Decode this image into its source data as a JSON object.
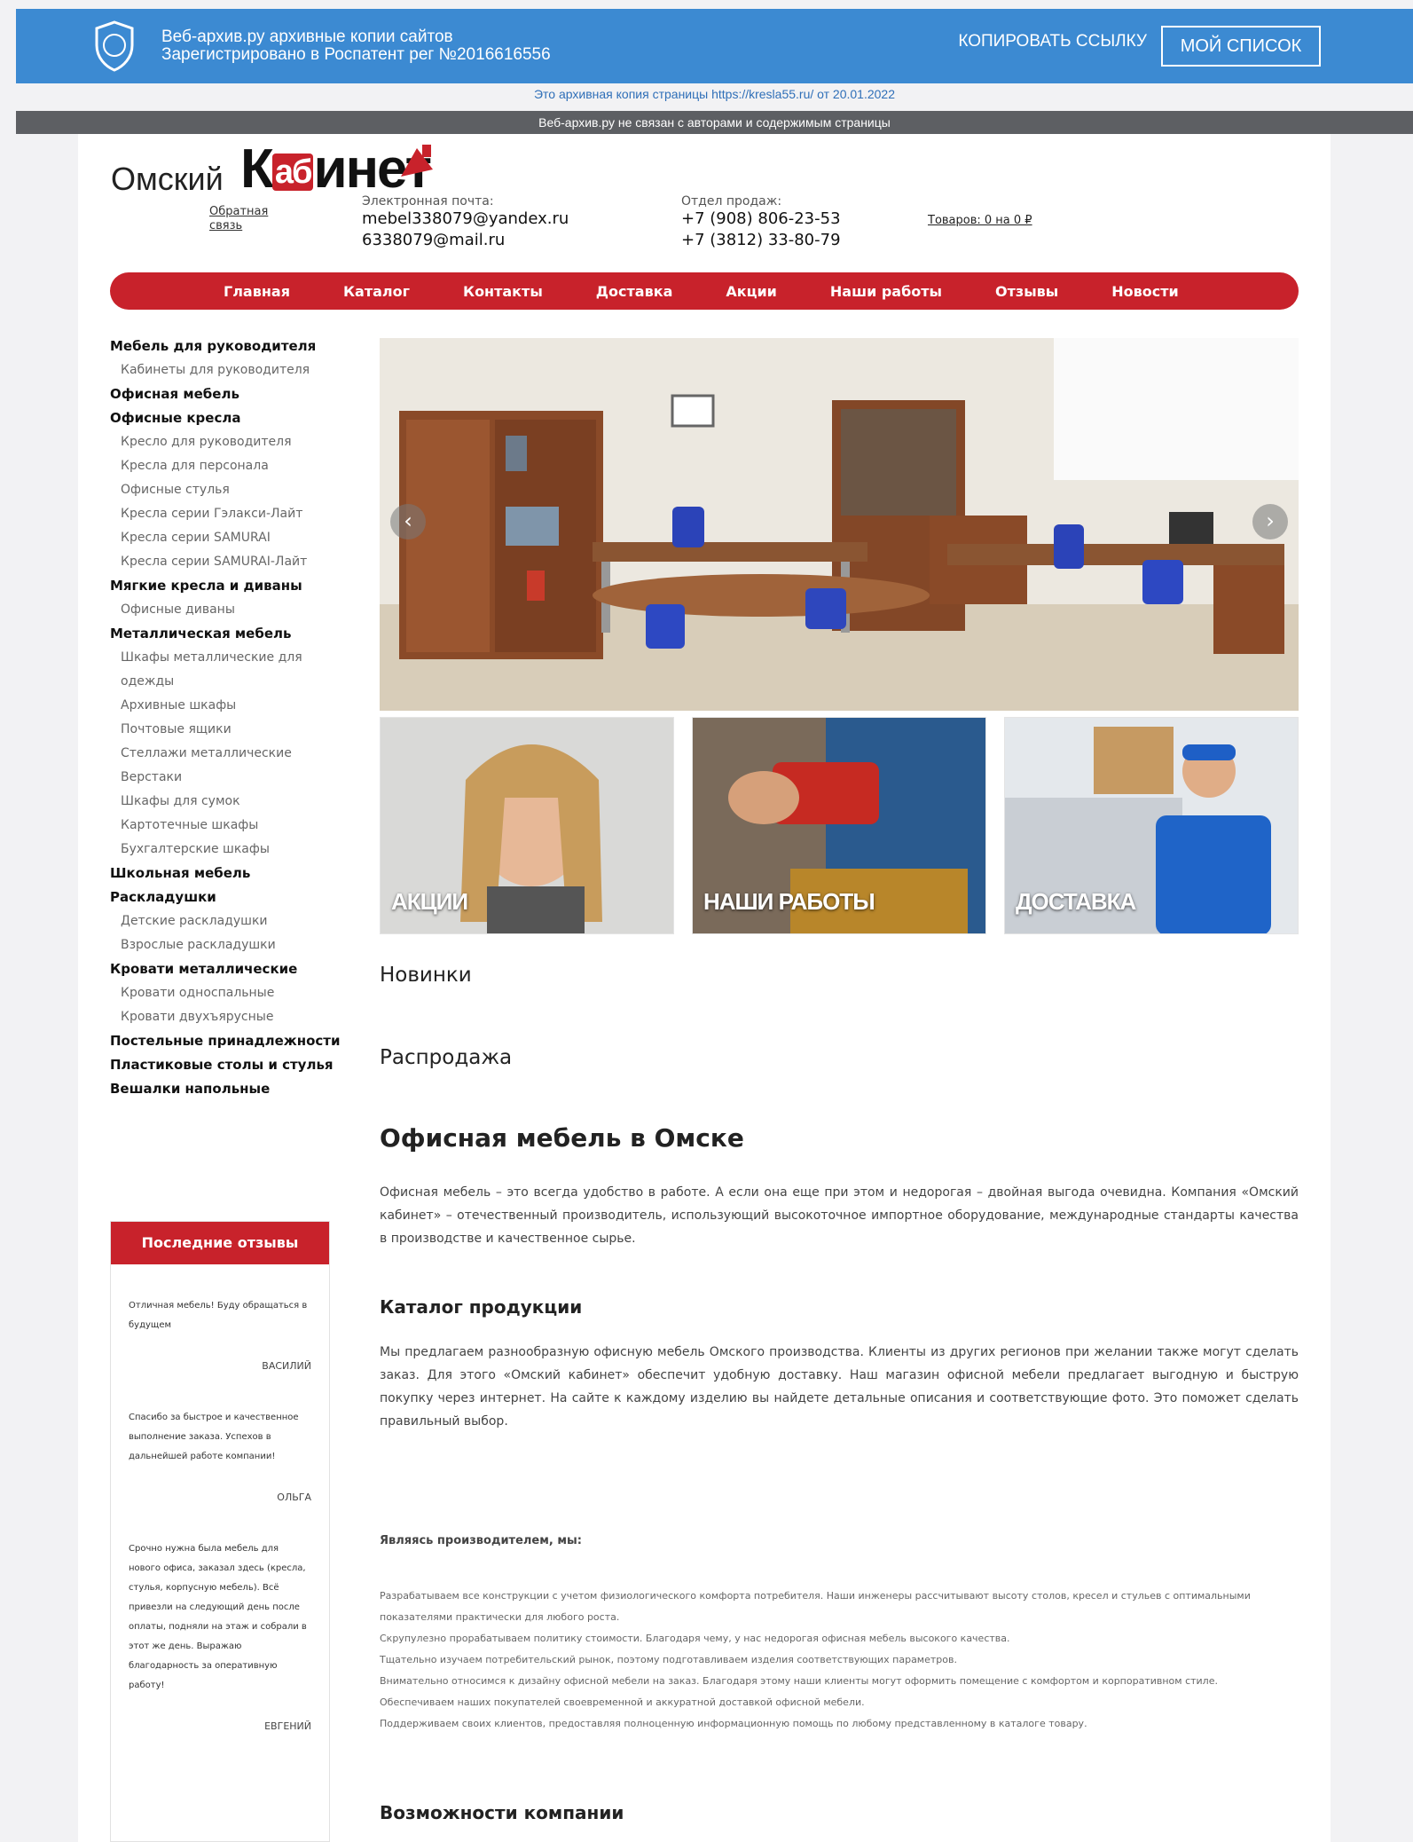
{
  "archive": {
    "title": "Веб-архив.ру архивные копии сайтов",
    "subtitle": "Зарегистрировано в Роспатент рег №2016616556",
    "copy_link": "КОПИРОВАТЬ ССЫЛКУ",
    "my_list": "МОЙ СПИСОК",
    "note": "Это архивная копия страницы https://kresla55.ru/ от 20.01.2022",
    "disclaimer": "Веб-архив.ру не связан с авторами и содержимым страницы",
    "shield_icon": "shield-icon"
  },
  "header": {
    "logo_small": "Омский",
    "logo_big_k": "К",
    "logo_big_ab": "аб",
    "logo_big_rest": "инет",
    "feedback": "Обратная связь",
    "email_label": "Электронная почта:",
    "email1": "mebel338079@yandex.ru",
    "email2": "6338079@mail.ru",
    "sales_label": "Отдел продаж:",
    "phone1": "+7 (908) 806-23-53",
    "phone2": "+7 (3812) 33-80-79",
    "cart": "Товаров: 0 на 0 ₽"
  },
  "nav": [
    "Главная",
    "Каталог",
    "Контакты",
    "Доставка",
    "Акции",
    "Наши работы",
    "Отзывы",
    "Новости"
  ],
  "sidebar": [
    {
      "t": "cat",
      "label": "Мебель для руководителя"
    },
    {
      "t": "sub",
      "label": "Кабинеты для руководителя"
    },
    {
      "t": "cat",
      "label": "Офисная мебель"
    },
    {
      "t": "cat",
      "label": "Офисные кресла"
    },
    {
      "t": "sub",
      "label": "Кресло для руководителя"
    },
    {
      "t": "sub",
      "label": "Кресла для персонала"
    },
    {
      "t": "sub",
      "label": "Офисные стулья"
    },
    {
      "t": "sub",
      "label": "Кресла серии Гэлакси-Лайт"
    },
    {
      "t": "sub",
      "label": "Кресла серии SAMURAI"
    },
    {
      "t": "sub",
      "label": "Кресла серии SAMURAI-Лайт"
    },
    {
      "t": "cat",
      "label": "Мягкие кресла и диваны"
    },
    {
      "t": "sub",
      "label": "Офисные диваны"
    },
    {
      "t": "cat",
      "label": "Металлическая мебель"
    },
    {
      "t": "sub",
      "label": "Шкафы металлические для одежды"
    },
    {
      "t": "sub",
      "label": "Архивные шкафы"
    },
    {
      "t": "sub",
      "label": "Почтовые ящики"
    },
    {
      "t": "sub",
      "label": "Стеллажи металлические"
    },
    {
      "t": "sub",
      "label": "Верстаки"
    },
    {
      "t": "sub",
      "label": "Шкафы для сумок"
    },
    {
      "t": "sub",
      "label": "Картотечные шкафы"
    },
    {
      "t": "sub",
      "label": "Бухгалтерские шкафы"
    },
    {
      "t": "cat",
      "label": "Школьная мебель"
    },
    {
      "t": "cat",
      "label": "Раскладушки"
    },
    {
      "t": "sub",
      "label": "Детские раскладушки"
    },
    {
      "t": "sub",
      "label": "Взрослые раскладушки"
    },
    {
      "t": "cat",
      "label": "Кровати металлические"
    },
    {
      "t": "sub",
      "label": "Кровати односпальные"
    },
    {
      "t": "sub",
      "label": "Кровати двухъярусные"
    },
    {
      "t": "cat",
      "label": "Постельные принадлежности"
    },
    {
      "t": "cat",
      "label": "Пластиковые столы и стулья"
    },
    {
      "t": "cat",
      "label": "Вешалки напольные"
    }
  ],
  "reviews": {
    "title": "Последние отзывы",
    "items": [
      {
        "text": "Отличная мебель! Буду обращаться в будущем",
        "author": "ВАСИЛИЙ"
      },
      {
        "text": "Спасибо за быстрое и качественное выполнение заказа. Успехов в дальнейшей работе компании!",
        "author": "ОЛЬГА"
      },
      {
        "text": "Срочно нужна была мебель для нового офиса, заказал здесь (кресла, стулья, корпусную мебель). Всё привезли на следующий день после оплаты, подняли на этаж и собрали в этот же день. Выражаю благодарность за оперативную работу!",
        "author": "ЕВГЕНИЙ"
      }
    ]
  },
  "tiles": [
    "АКЦИИ",
    "НАШИ РАБОТЫ",
    "ДОСТАВКА"
  ],
  "slider": {
    "prev_icon": "chevron-left-icon",
    "next_icon": "chevron-right-icon"
  },
  "content": {
    "new": "Новинки",
    "sale": "Распродажа",
    "main_title": "Офисная мебель в Омске",
    "intro": "Офисная мебель – это всегда удобство в работе. А если она еще при этом и недорогая – двойная выгода очевидна. Компания «Омский кабинет» – отечественный производитель, использующий высокоточное импортное оборудование, международные стандарты качества в производстве и качественное сырье.",
    "catalog_title": "Каталог продукции",
    "catalog_text": "Мы предлагаем разнообразную офисную мебель Омского производства. Клиенты из других регионов при желании также могут сделать заказ. Для этого «Омский кабинет» обеспечит удобную доставку. Наш магазин офисной мебели предлагает выгодную и быструю покупку через интернет. На сайте к каждому изделию вы найдете детальные описания и соответствующие фото. Это поможет сделать правильный выбор.",
    "producer_title": "Являясь производителем, мы:",
    "producer_lines": [
      "Разрабатываем все конструкции с учетом физиологического комфорта потребителя. Наши инженеры рассчитывают высоту столов, кресел и стульев с оптимальными показателями практически для любого роста.",
      "Скрупулезно прорабатываем политику стоимости. Благодаря чему, у нас недорогая офисная мебель высокого качества.",
      "Тщательно изучаем потребительский рынок, поэтому подготавливаем изделия соответствующих параметров.",
      "Внимательно относимся к дизайну офисной мебели на заказ. Благодаря этому наши клиенты могут оформить помещение с комфортом и корпоративном стиле.",
      "Обеспечиваем наших покупателей своевременной и аккуратной доставкой офисной мебели.",
      "Поддерживаем своих клиентов, предоставляя полноценную информационную помощь по любому представленному в каталоге товару."
    ],
    "capabilities_title": "Возможности компании"
  }
}
